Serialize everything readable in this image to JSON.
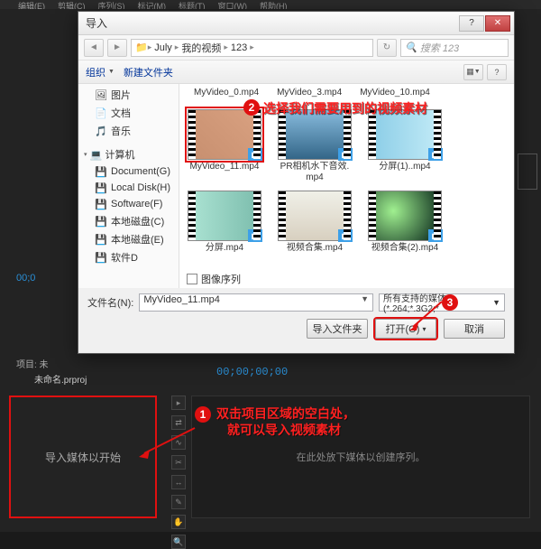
{
  "menus": [
    "编辑(E)",
    "剪辑(C)",
    "序列(S)",
    "标记(M)",
    "标题(T)",
    "窗口(W)",
    "帮助(H)"
  ],
  "dialog": {
    "title": "导入",
    "breadcrumb": [
      "July",
      "我的视频",
      "123"
    ],
    "search_placeholder": "搜索 123",
    "toolbar": {
      "organize": "组织",
      "new_folder": "新建文件夹"
    },
    "sidebar": {
      "items": [
        "图片",
        "文档",
        "音乐"
      ],
      "computer": "计算机",
      "drives": [
        "Document(G)",
        "Local Disk(H)",
        "Software(F)",
        "本地磁盘(C)",
        "本地磁盘(E)",
        "软件D"
      ]
    },
    "truncated_row": [
      "MyVideo_0.mp4",
      "MyVideo_3.mp4",
      "MyVideo_10.mp4"
    ],
    "files": [
      {
        "label": "MyVideo_11.mp4",
        "selected": true,
        "bg": "linear-gradient(45deg,#c89070,#d8a080)"
      },
      {
        "label": "PR相机水下音效.mp4",
        "selected": false,
        "bg": "linear-gradient(180deg,#88bbdd,#336688)"
      },
      {
        "label": "分屏(1)..mp4",
        "selected": false,
        "bg": "linear-gradient(90deg,#8fcfe8,#bde8f5)"
      },
      {
        "label": "分屏.mp4",
        "selected": false,
        "bg": "linear-gradient(90deg,#a8e0d0,#80c0b0)"
      },
      {
        "label": "视频合集.mp4",
        "selected": false,
        "bg": "linear-gradient(180deg,#f0f0e8,#d8d0c0)"
      },
      {
        "label": "视频合集(2).mp4",
        "selected": false,
        "bg": "radial-gradient(circle at 30% 40%,#a0f090,#103020)"
      }
    ],
    "image_sequence": "图像序列",
    "filename_label": "文件名(N):",
    "filename_value": "MyVideo_11.mp4",
    "filter": "所有支持的媒体 (*.264;*.3G2;*",
    "btn_import_folder": "导入文件夹",
    "btn_open": "打开(O)",
    "btn_cancel": "取消"
  },
  "annotations": {
    "n1": "1",
    "n2": "2",
    "n3": "3",
    "text2": "选择我们需要用到的视频素材",
    "text1a": "双击项目区域的空白处，",
    "text1b": "就可以导入视频素材"
  },
  "app": {
    "timecode_left": "00;0",
    "project_tab": "项目: 未",
    "project_name": "未命名.prproj",
    "tl_timecode": "00;00;00;00",
    "empty_panel": "导入媒体以开始",
    "tl_placeholder": "在此处放下媒体以创建序列。"
  }
}
